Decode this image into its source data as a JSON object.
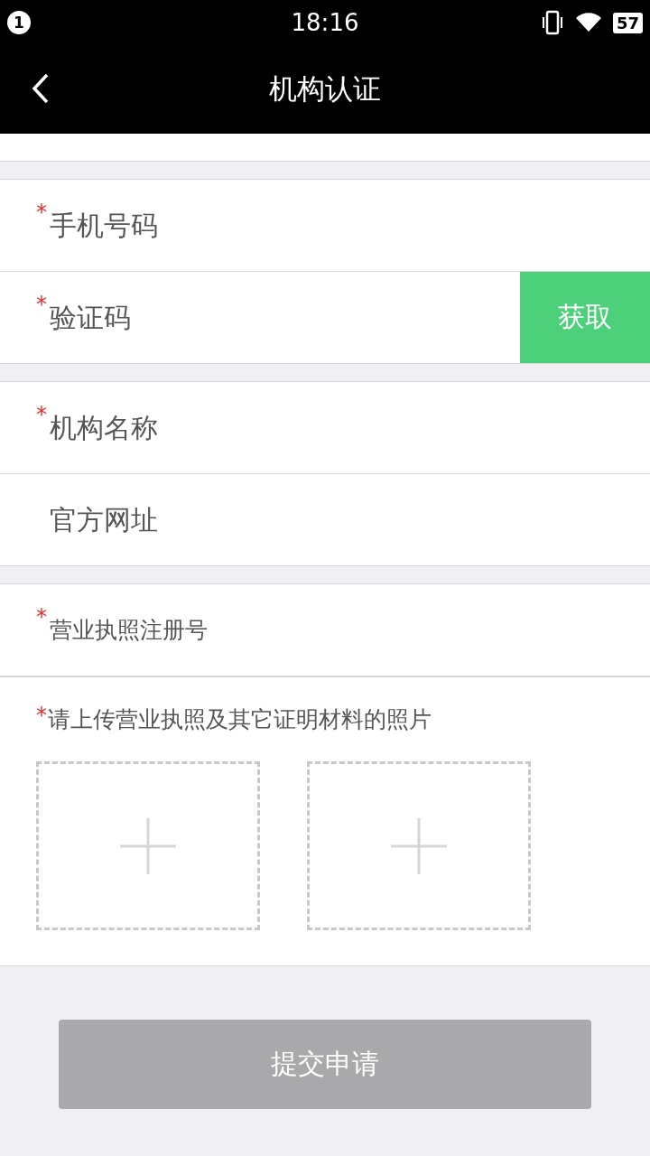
{
  "status_bar": {
    "notification_count": "1",
    "time": "18:16",
    "battery": "57"
  },
  "nav": {
    "title": "机构认证"
  },
  "groups": [
    {
      "fields": [
        {
          "kind": "input",
          "mark": "*",
          "placeholder": "手机号码"
        },
        {
          "kind": "code",
          "mark": "*",
          "placeholder": "验证码",
          "button": "获取"
        }
      ]
    },
    {
      "fields": [
        {
          "kind": "input",
          "mark": "*",
          "placeholder": "机构名称"
        },
        {
          "kind": "input",
          "placeholder": "官方网址"
        }
      ]
    },
    {
      "fields": [
        {
          "kind": "small",
          "mark": "*",
          "placeholder": "营业执照注册号"
        },
        {
          "kind": "upload",
          "mark": "*",
          "label": "请上传营业执照及其它证明材料的照片",
          "slots": [
            {
              "kind": "add"
            },
            {
              "kind": "add"
            }
          ]
        }
      ]
    }
  ],
  "submit": {
    "label": "提交申请",
    "disabled": true
  }
}
